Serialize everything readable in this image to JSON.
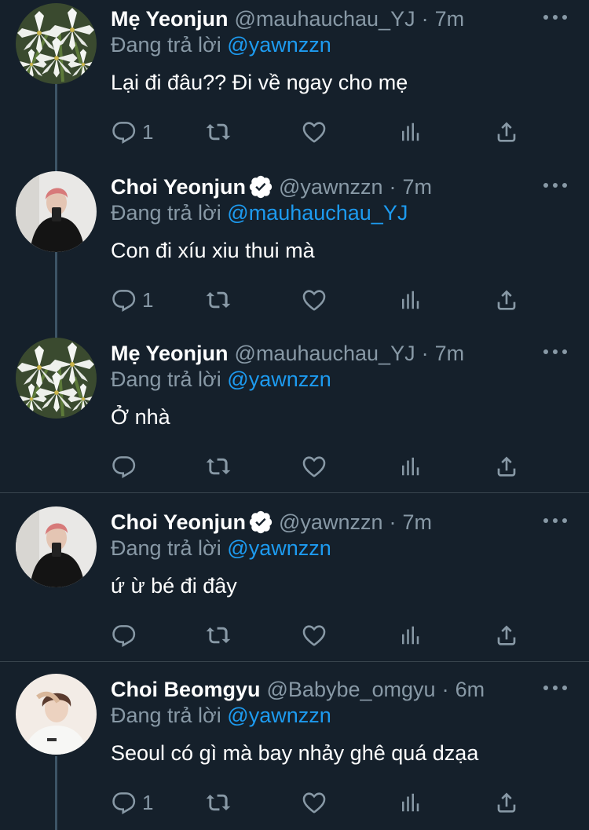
{
  "reply_prefix": "Đang trả lời",
  "colors": {
    "background": "#15202b",
    "mention": "#1d9bf0",
    "muted": "#8899a6",
    "verified": "#ffffff"
  },
  "tweets": [
    {
      "name": "Mẹ Yeonjun",
      "handle": "@mauhauchau_YJ",
      "separator": "·",
      "time": "7m",
      "verified": false,
      "replying_to": "@yawnzzn",
      "text": "Lại đi đâu?? Đi về ngay cho mẹ",
      "reply_count": "1",
      "avatar": "lily-flowers"
    },
    {
      "name": "Choi Yeonjun",
      "handle": "@yawnzzn",
      "separator": "·",
      "time": "7m",
      "verified": true,
      "replying_to": "@mauhauchau_YJ",
      "text": "Con đi xíu xiu thui mà",
      "reply_count": "1",
      "avatar": "man-black-outfit"
    },
    {
      "name": "Mẹ Yeonjun",
      "handle": "@mauhauchau_YJ",
      "separator": "·",
      "time": "7m",
      "verified": false,
      "replying_to": "@yawnzzn",
      "text": "Ở nhà",
      "reply_count": "",
      "avatar": "lily-flowers"
    },
    {
      "name": "Choi Yeonjun",
      "handle": "@yawnzzn",
      "separator": "·",
      "time": "7m",
      "verified": true,
      "replying_to": "@yawnzzn",
      "text": "ứ ừ bé đi đây",
      "reply_count": "",
      "avatar": "man-black-outfit"
    },
    {
      "name": "Choi Beomgyu",
      "handle": "@Babybe_omgyu",
      "separator": "·",
      "time": "6m",
      "verified": false,
      "replying_to": "@yawnzzn",
      "text": "Seoul có gì mà bay nhảy ghê quá dzạa",
      "reply_count": "1",
      "avatar": "boy-white-shirt"
    }
  ],
  "icons": [
    "reply-icon",
    "retweet-icon",
    "like-icon",
    "analytics-icon",
    "share-icon",
    "more-icon",
    "verified-badge-icon"
  ]
}
